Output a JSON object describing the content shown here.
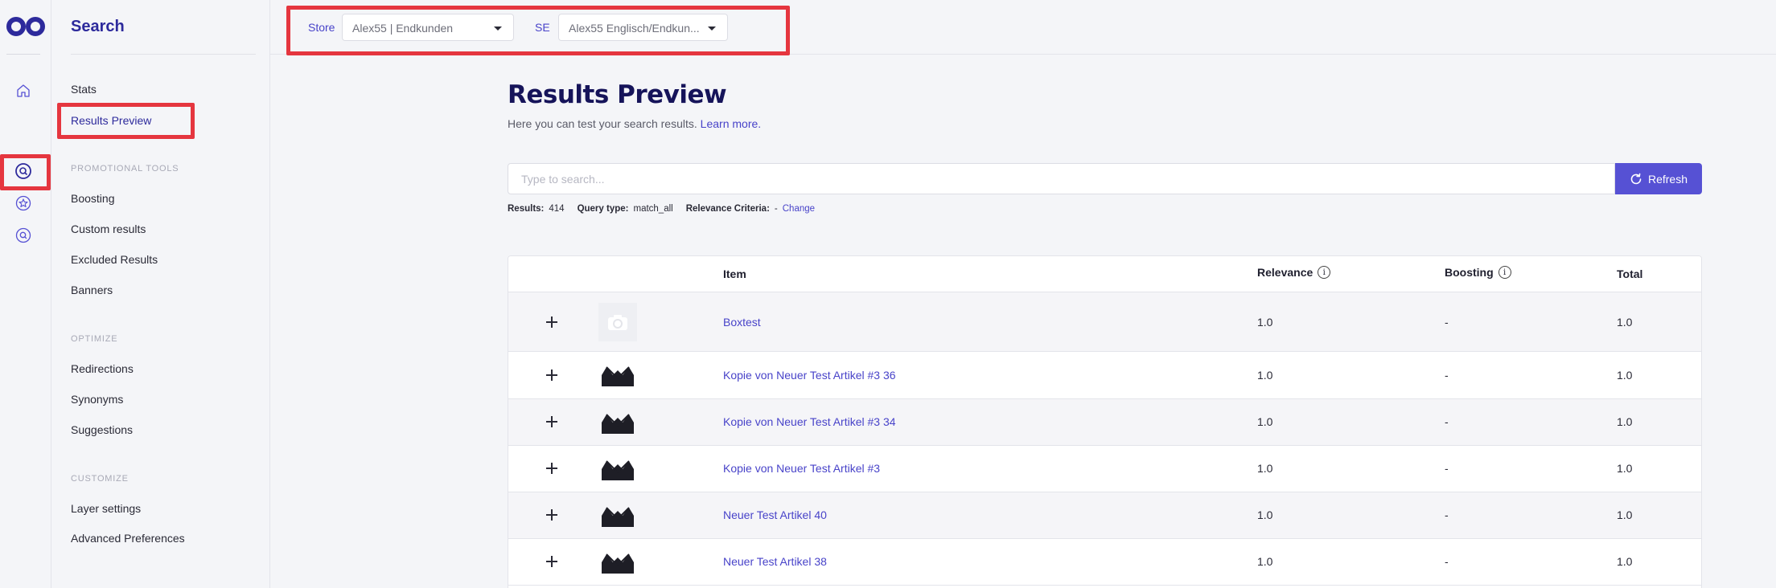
{
  "rail": {
    "icons": [
      "logo-icon",
      "home-icon",
      "search-icon",
      "star-icon",
      "search-alt-icon"
    ]
  },
  "sidebar": {
    "title": "Search",
    "items": [
      {
        "label": "Stats"
      },
      {
        "label": "Results Preview",
        "active": true
      }
    ],
    "sections": [
      {
        "title": "PROMOTIONAL TOOLS",
        "items": [
          "Boosting",
          "Custom results",
          "Excluded Results",
          "Banners"
        ]
      },
      {
        "title": "OPTIMIZE",
        "items": [
          "Redirections",
          "Synonyms",
          "Suggestions"
        ]
      },
      {
        "title": "CUSTOMIZE",
        "items": [
          "Layer settings",
          "Advanced Preferences"
        ]
      }
    ]
  },
  "topbar": {
    "store_label": "Store",
    "store_value": "Alex55 | Endkunden",
    "se_label": "SE",
    "se_value": "Alex55 Englisch/Endkun..."
  },
  "page": {
    "title": "Results Preview",
    "subtitle": "Here you can test your search results.",
    "learn_more": "Learn more.",
    "search_placeholder": "Type to search...",
    "refresh_label": "Refresh"
  },
  "meta": {
    "results_label": "Results:",
    "results_value": "414",
    "query_type_label": "Query type:",
    "query_type_value": "match_all",
    "relevance_label": "Relevance Criteria:",
    "relevance_value": "-",
    "change_label": "Change"
  },
  "table": {
    "headers": {
      "item": "Item",
      "relevance": "Relevance",
      "boosting": "Boosting",
      "total": "Total"
    },
    "rows": [
      {
        "item": "Boxtest",
        "relevance": "1.0",
        "boosting": "-",
        "total": "1.0",
        "thumb": "placeholder-icon"
      },
      {
        "item": "Kopie von Neuer Test Artikel #3 36",
        "relevance": "1.0",
        "boosting": "-",
        "total": "1.0",
        "thumb": "bra-product-image"
      },
      {
        "item": "Kopie von Neuer Test Artikel #3 34",
        "relevance": "1.0",
        "boosting": "-",
        "total": "1.0",
        "thumb": "bra-product-image"
      },
      {
        "item": "Kopie von Neuer Test Artikel #3",
        "relevance": "1.0",
        "boosting": "-",
        "total": "1.0",
        "thumb": "bra-product-image"
      },
      {
        "item": "Neuer Test Artikel 40",
        "relevance": "1.0",
        "boosting": "-",
        "total": "1.0",
        "thumb": "bra-product-image"
      },
      {
        "item": "Neuer Test Artikel 38",
        "relevance": "1.0",
        "boosting": "-",
        "total": "1.0",
        "thumb": "bra-product-image"
      }
    ]
  },
  "colors": {
    "accent": "#4843c9",
    "button": "#5651d4",
    "highlight": "#e5363f",
    "title": "#16145a"
  }
}
